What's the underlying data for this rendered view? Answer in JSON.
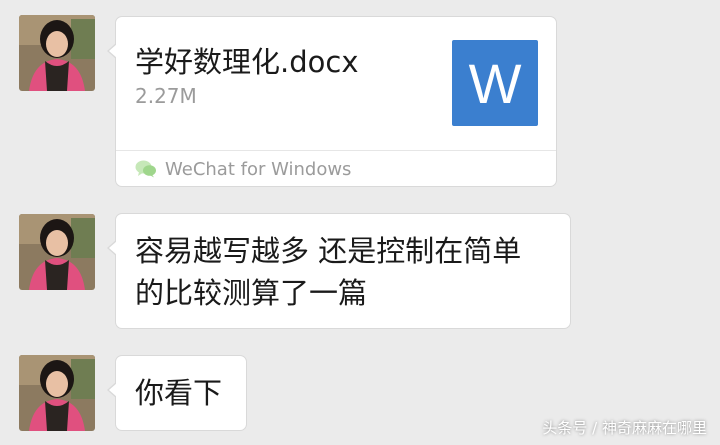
{
  "messages": [
    {
      "type": "file",
      "file_name": "学好数理化.docx",
      "file_size": "2.27M",
      "file_icon_letter": "W",
      "file_icon_color": "#3b7fcf",
      "source": "WeChat for Windows",
      "source_icon": "wechat-icon"
    },
    {
      "type": "text",
      "text": "容易越写越多 还是控制在简单\n的比较测算了一篇"
    },
    {
      "type": "text",
      "text": "你看下"
    }
  ],
  "watermark": "头条号 / 神奇麻麻在哪里",
  "colors": {
    "background": "#ebebeb",
    "bubble": "#ffffff",
    "word_blue": "#3b7fcf",
    "secondary_text": "#9b9b9b"
  }
}
